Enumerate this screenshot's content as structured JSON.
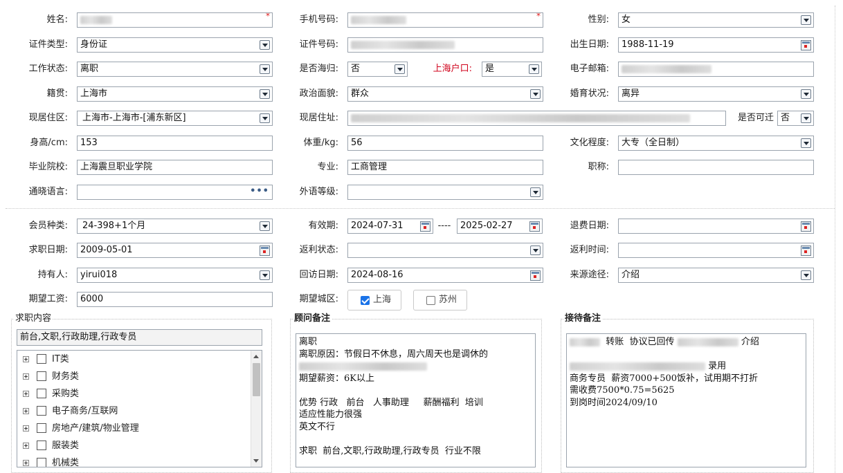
{
  "labels": {
    "name": "姓名:",
    "mobile": "手机号码:",
    "gender": "性别:",
    "id_type": "证件类型:",
    "id_no": "证件号码:",
    "birth": "出生日期:",
    "work_status": "工作状态:",
    "returnee": "是否海归:",
    "sh_hukou": "上海户口:",
    "email": "电子邮箱:",
    "native": "籍贯:",
    "political": "政治面貌:",
    "marital": "婚育状况:",
    "residence_area": "现居住区:",
    "residence_addr": "现居住址:",
    "relocate": "是否可迁",
    "height": "身高/cm:",
    "weight": "体重/kg:",
    "education": "文化程度:",
    "school": "毕业院校:",
    "major": "专业:",
    "title": "职称:",
    "languages": "通晓语言:",
    "foreign_level": "外语等级:",
    "member_type": "会员种类:",
    "validity": "有效期:",
    "range_sep": "----",
    "refund_date": "退费日期:",
    "job_date": "求职日期:",
    "rebate_status": "返利状态:",
    "rebate_time": "返利时间:",
    "holder": "持有人:",
    "visit_date": "回访日期:",
    "source": "来源途径:",
    "salary": "期望工资:",
    "city": "期望城区:"
  },
  "values": {
    "gender": "女",
    "id_type": "身份证",
    "birth": "1988-11-19",
    "work_status": "离职",
    "returnee": "否",
    "sh_hukou": "是",
    "native": "上海市",
    "political": "群众",
    "marital": "离异",
    "residence_area": "上海市-上海市-[浦东新区]",
    "relocate": "否",
    "height": "153",
    "weight": "56",
    "education": "大专（全日制）",
    "school": "上海震旦职业学院",
    "major": "工商管理",
    "title": "",
    "languages": "",
    "foreign_level": "",
    "member_type": "24-398+1个月",
    "valid_from": "2024-07-31",
    "valid_to": "2025-02-27",
    "refund_date": "",
    "job_date": "2009-05-01",
    "rebate_status": "",
    "rebate_time": "",
    "holder": "yirui018",
    "visit_date": "2024-08-16",
    "source": "介绍",
    "salary": "6000"
  },
  "city_options": [
    {
      "label": "上海",
      "checked": true
    },
    {
      "label": "苏州",
      "checked": false
    }
  ],
  "job_content": {
    "title": "求职内容",
    "selected": "前台,文职,行政助理,行政专员",
    "categories": [
      "IT类",
      "财务类",
      "采购类",
      "电子商务/互联网",
      "房地产/建筑/物业管理",
      "服装类",
      "机械类"
    ]
  },
  "consultant_note": {
    "title": "顾问备注",
    "lines": [
      "离职",
      "离职原因：节假日不休息，周六周天也是调休的",
      "",
      "期望薪资：6K以上",
      "",
      "优势 行政   前台   人事助理     薪酬福利  培训",
      "适应性能力很强",
      "英文不行",
      "",
      "求职  前台,文职,行政助理,行政专员  行业不限"
    ]
  },
  "reception_note": {
    "title": "接待备注",
    "line1_a": "转账  协议已回传",
    "line1_b": "介绍",
    "line3": "录用",
    "lines_rest": [
      "商务专员  薪资7000+500饭补，试用期不打折",
      "需收费7500*0.75=5625",
      "到岗时间2024/09/10"
    ]
  },
  "required_mark": "*",
  "more_dots": "•••"
}
